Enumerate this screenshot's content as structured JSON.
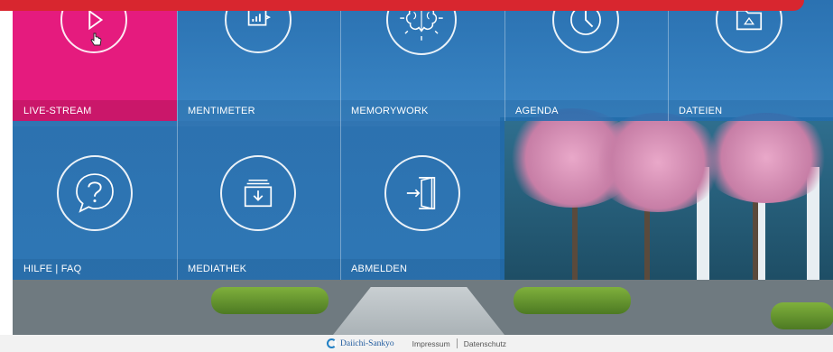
{
  "tiles": {
    "live_stream": "LIVE-STREAM",
    "mentimeter": "MENTIMETER",
    "memorywork": "MEMORYWORK",
    "agenda": "AGENDA",
    "dateien": "DATEIEN",
    "hilfe_faq": "HILFE | FAQ",
    "mediathek": "MEDIATHEK",
    "abmelden": "ABMELDEN"
  },
  "icons": {
    "live_stream": "play-icon",
    "mentimeter": "bar-chart-icon",
    "memorywork": "brain-icon",
    "agenda": "clock-icon",
    "dateien": "folder-icon",
    "hilfe_faq": "question-bubble-icon",
    "mediathek": "archive-download-icon",
    "abmelden": "logout-door-icon"
  },
  "footer": {
    "brand": "Daiichi-Sankyo",
    "impressum": "Impressum",
    "datenschutz": "Datenschutz"
  },
  "colors": {
    "active_tile": "#e51b7e",
    "tile_blue": "#2068aa",
    "top_bar": "#d8262f",
    "footer_bg": "#f2f2f2"
  }
}
